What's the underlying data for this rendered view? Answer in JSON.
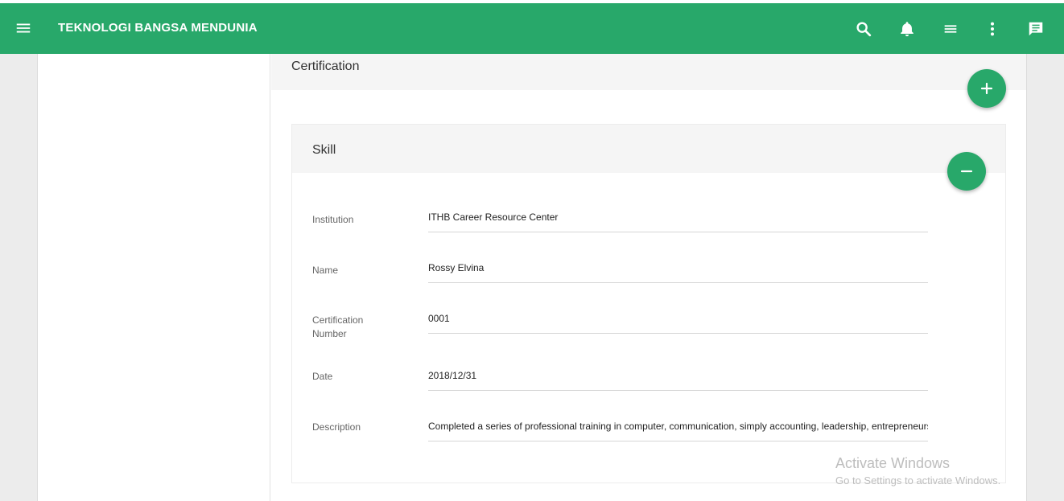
{
  "header": {
    "app_title": "TEKNOLOGI BANGSA MENDUNIA",
    "icons": [
      "menu-icon",
      "search-icon",
      "bell-icon",
      "list-icon",
      "more-vert-icon",
      "chat-icon"
    ],
    "bg_color": "#28a86a"
  },
  "section": {
    "title": "Certification"
  },
  "skill": {
    "title": "Skill",
    "fields": [
      {
        "label": "Institution",
        "value": "ITHB Career Resource Center"
      },
      {
        "label": "Name",
        "value": "Rossy Elvina"
      },
      {
        "label": "Certification\nNumber",
        "value": "0001"
      },
      {
        "label": "Date",
        "value": "2018/12/31"
      },
      {
        "label": "Description",
        "value": "Completed a series of professional training in computer, communication, simply accounting, leadership, entrepreneurship"
      }
    ]
  },
  "buttons": {
    "add_icon": "plus-icon",
    "remove_icon": "minus-icon"
  },
  "watermark": {
    "title": "Activate Windows",
    "subtitle": "Go to Settings to activate Windows."
  }
}
